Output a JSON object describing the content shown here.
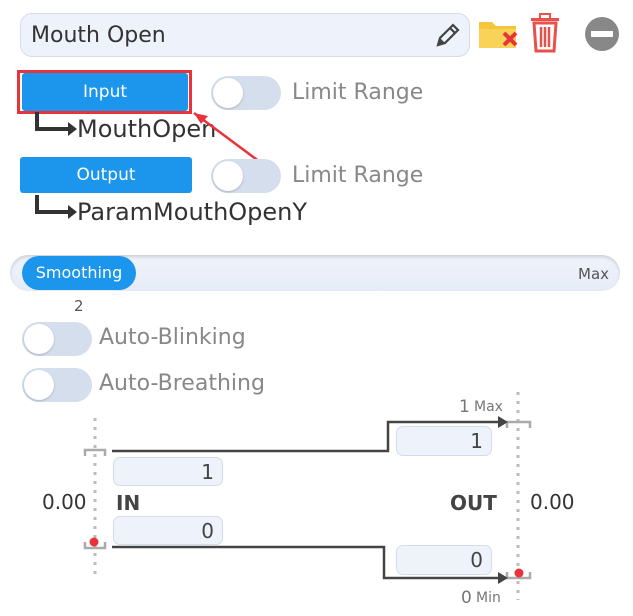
{
  "header": {
    "name_value": "Mouth Open"
  },
  "input": {
    "button_label": "Input",
    "limit_range_label": "Limit Range",
    "parameter": "MouthOpen"
  },
  "output": {
    "button_label": "Output",
    "limit_range_label": "Limit Range",
    "parameter": "ParamMouthOpenY"
  },
  "smoothing": {
    "label": "Smoothing",
    "max_label": "Max",
    "value": "2"
  },
  "toggles": {
    "auto_blinking": "Auto-Blinking",
    "auto_breathing": "Auto-Breathing"
  },
  "mapping": {
    "in_label": "IN",
    "out_label": "OUT",
    "in_current": "0.00",
    "out_current": "0.00",
    "in_max": "1",
    "in_min": "0",
    "out_max": "1",
    "out_min": "0",
    "max_number": "1",
    "max_word": "Max",
    "min_number": "0",
    "min_word": "Min"
  },
  "colors": {
    "accent": "#1b96ec",
    "highlight": "#e8333b",
    "trash": "#e8504a",
    "folder": "#f5c63b"
  }
}
